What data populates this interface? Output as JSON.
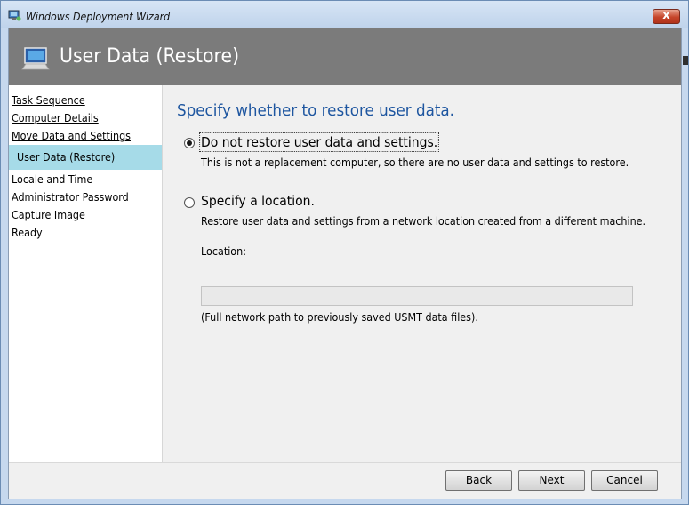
{
  "window": {
    "title": "Windows Deployment Wizard",
    "close_glyph": "x"
  },
  "banner": {
    "title": "User Data (Restore)",
    "icon": "computer-icon"
  },
  "nav": {
    "items": [
      {
        "label": "Task Sequence",
        "state": "completed"
      },
      {
        "label": "Computer Details",
        "state": "completed"
      },
      {
        "label": "Move Data and Settings",
        "state": "completed"
      },
      {
        "label": "User Data (Restore)",
        "state": "current"
      },
      {
        "label": "Locale and Time",
        "state": "pending"
      },
      {
        "label": "Administrator Password",
        "state": "pending"
      },
      {
        "label": "Capture Image",
        "state": "pending"
      },
      {
        "label": "Ready",
        "state": "pending"
      }
    ]
  },
  "main": {
    "heading": "Specify whether to restore user data.",
    "options": [
      {
        "label": "Do not restore user data and settings.",
        "description": "This is not a replacement computer, so there are no user data and settings to restore.",
        "selected": true
      },
      {
        "label": "Specify a location.",
        "description": "Restore user data and settings from a network location created from a different machine.",
        "selected": false
      }
    ],
    "location": {
      "label": "Location:",
      "value": "",
      "hint": "(Full network path to previously saved USMT data files)."
    }
  },
  "footer": {
    "back_label": "Back",
    "next_label": "Next",
    "cancel_label": "Cancel"
  },
  "colors": {
    "banner_bg": "#7b7b7b",
    "heading": "#1e56a0",
    "nav_current_bg": "#a6dbe8"
  }
}
